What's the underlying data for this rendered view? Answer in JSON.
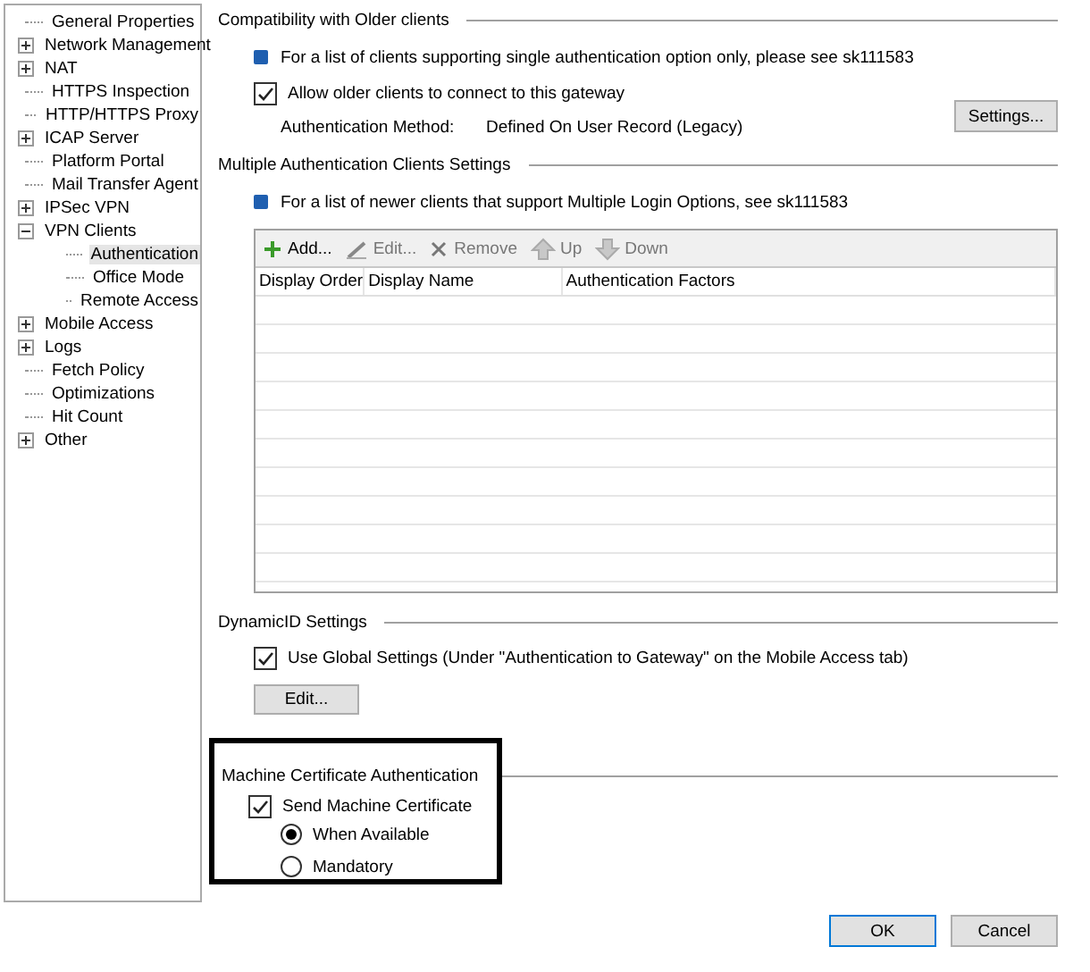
{
  "tree": [
    {
      "label": "General Properties",
      "kind": "leaf",
      "selected": false
    },
    {
      "label": "Network Management",
      "kind": "node",
      "expanded": false,
      "selected": false
    },
    {
      "label": "NAT",
      "kind": "node",
      "expanded": false,
      "selected": false
    },
    {
      "label": "HTTPS Inspection",
      "kind": "leaf",
      "selected": false
    },
    {
      "label": "HTTP/HTTPS Proxy",
      "kind": "leaf",
      "selected": false
    },
    {
      "label": "ICAP Server",
      "kind": "node",
      "expanded": false,
      "selected": false
    },
    {
      "label": "Platform Portal",
      "kind": "leaf",
      "selected": false
    },
    {
      "label": "Mail Transfer Agent",
      "kind": "leaf",
      "selected": false
    },
    {
      "label": "IPSec VPN",
      "kind": "node",
      "expanded": false,
      "selected": false
    },
    {
      "label": "VPN Clients",
      "kind": "node",
      "expanded": true,
      "selected": false,
      "children": [
        {
          "label": "Authentication",
          "selected": true
        },
        {
          "label": "Office Mode",
          "selected": false
        },
        {
          "label": "Remote Access",
          "selected": false
        }
      ]
    },
    {
      "label": "Mobile Access",
      "kind": "node",
      "expanded": false,
      "selected": false
    },
    {
      "label": "Logs",
      "kind": "node",
      "expanded": false,
      "selected": false
    },
    {
      "label": "Fetch Policy",
      "kind": "leaf",
      "selected": false
    },
    {
      "label": "Optimizations",
      "kind": "leaf",
      "selected": false
    },
    {
      "label": "Hit Count",
      "kind": "leaf",
      "selected": false
    },
    {
      "label": "Other",
      "kind": "node",
      "expanded": false,
      "selected": false
    }
  ],
  "compatibility": {
    "title": "Compatibility with Older clients",
    "info": "For a list of clients supporting single authentication option only, please see sk111583",
    "allow": {
      "label": "Allow older clients to connect to this gateway",
      "checked": true
    },
    "method_label": "Authentication Method:",
    "method_value": "Defined On User Record (Legacy)",
    "settings_button": "Settings..."
  },
  "multiple": {
    "title": "Multiple Authentication Clients Settings",
    "info": "For a list of newer clients that support Multiple Login Options, see sk111583",
    "toolbar": [
      {
        "kind": "add",
        "label": "Add...",
        "disabled": false
      },
      {
        "kind": "edit",
        "label": "Edit...",
        "disabled": true
      },
      {
        "kind": "remove",
        "label": "Remove",
        "disabled": true
      },
      {
        "kind": "up",
        "label": "Up",
        "disabled": true
      },
      {
        "kind": "down",
        "label": "Down",
        "disabled": true
      }
    ],
    "columns": [
      "Display Order",
      "Display Name",
      "Authentication Factors"
    ]
  },
  "dynamic_id": {
    "title": "DynamicID Settings",
    "use_global": {
      "label": "Use Global Settings (Under \"Authentication to Gateway\" on the Mobile Access tab)",
      "checked": true
    },
    "edit_button": "Edit..."
  },
  "machine_cert": {
    "title": "Machine Certificate Authentication",
    "send": {
      "label": "Send Machine Certificate",
      "checked": true
    },
    "options": [
      {
        "label": "When Available",
        "selected": true
      },
      {
        "label": "Mandatory",
        "selected": false
      }
    ]
  },
  "buttons": [
    "OK",
    "Cancel"
  ]
}
